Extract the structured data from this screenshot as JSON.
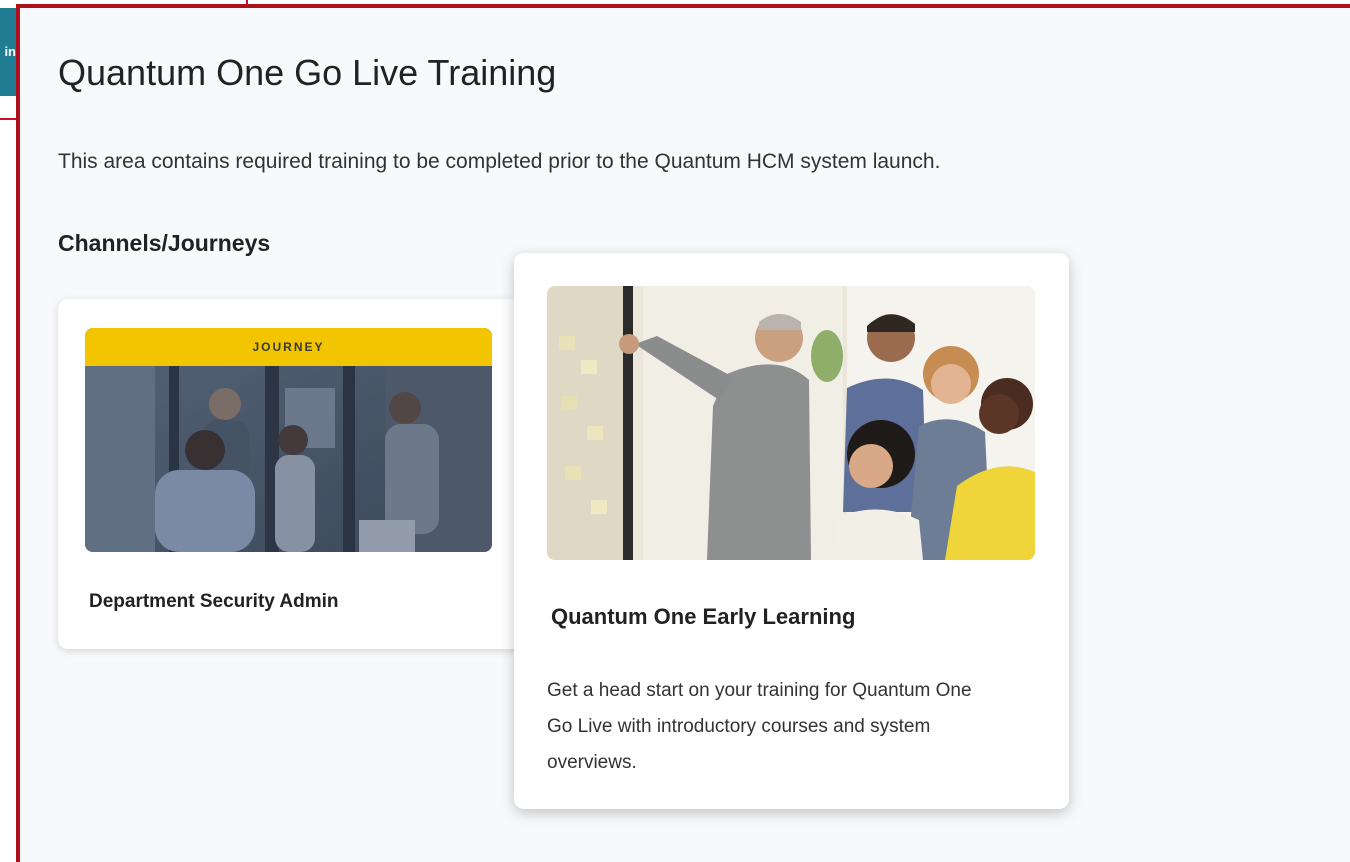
{
  "background": {
    "tab_label": "in"
  },
  "page": {
    "title": "Quantum One Go Live Training",
    "description": "This area contains required training to be completed prior to the Quantum HCM system launch.",
    "section_heading": "Channels/Journeys"
  },
  "cards": [
    {
      "banner": "JOURNEY",
      "title": "Department Security Admin"
    },
    {
      "title": "Quantum One Early Learning",
      "description": "Get a head start on your training for Quantum One Go Live with introductory courses and system overviews."
    }
  ],
  "colors": {
    "highlight_border": "#b0101d",
    "journey_banner": "#f2c500",
    "background_tab": "#1f7c93"
  }
}
